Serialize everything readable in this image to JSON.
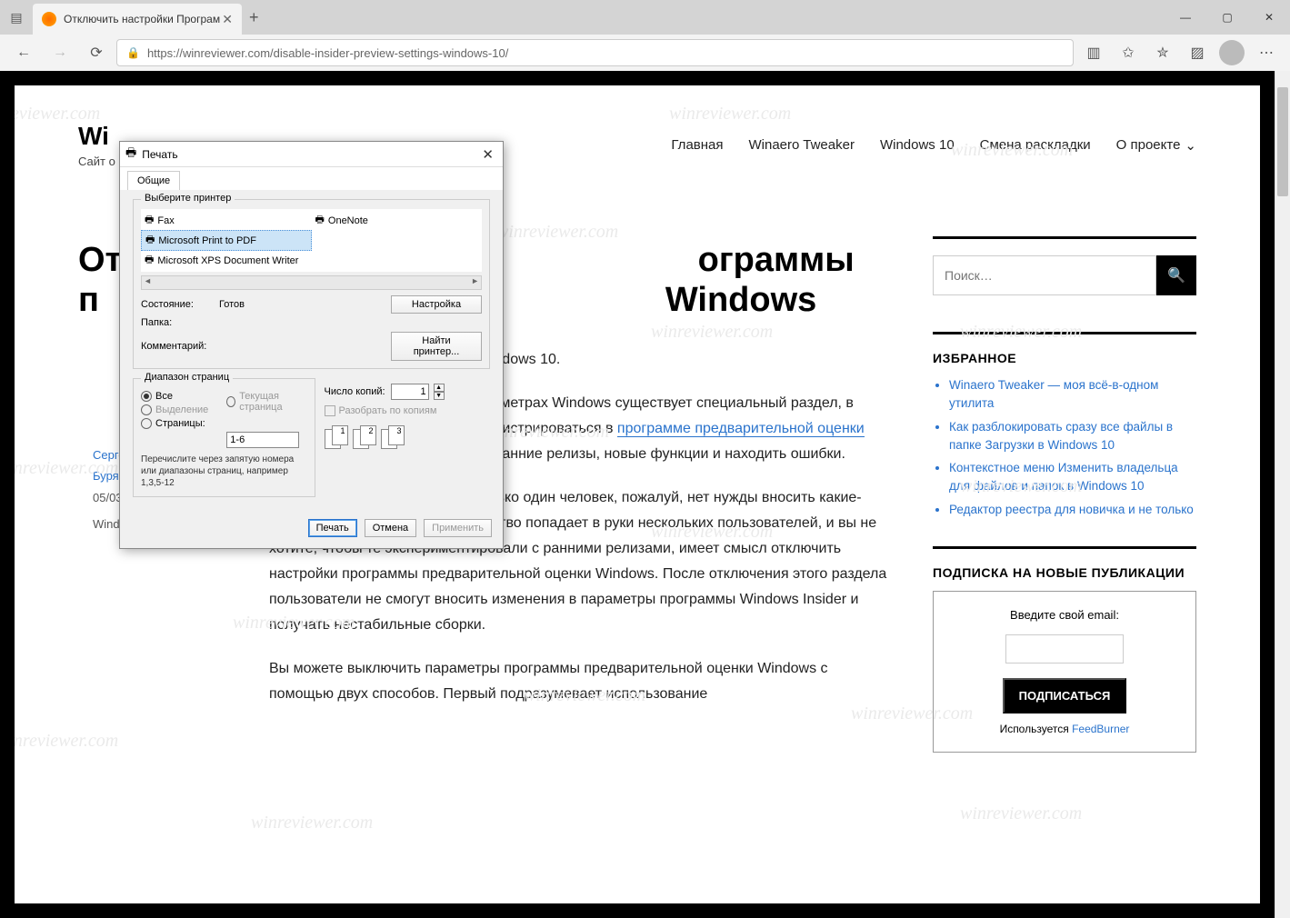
{
  "browser": {
    "tab_title": "Отключить настройки Програм",
    "new_tab_tooltip": "+",
    "url": "https://winreviewer.com/disable-insider-preview-settings-windows-10/",
    "window_controls": {
      "min": "—",
      "max": "▢",
      "close": "✕"
    },
    "nav": {
      "back": "←",
      "forward": "→",
      "refresh": "⟳"
    }
  },
  "site": {
    "title_visible_prefix": "Wi",
    "tagline_visible_prefix": "Сайт о",
    "nav": [
      "Главная",
      "Winaero Tweaker",
      "Windows 10",
      "Смена раскладки",
      "О проекте"
    ]
  },
  "article": {
    "title": "Отключить настройки Программы предварительной оценки Windows",
    "title_visible": "От                                                            ограммы\nп                                                           Windows",
    "author_prefix": "Серге",
    "author_lastname": "Буря",
    "date_prefix": "05/03/",
    "category": "Windows 10",
    "p1_visible_suffix": "ммы предварительной оценки Windows 10.",
    "p2_a": "На протяжении многих лет в Параметрах Windows существует специальный раздел, в котором пользователи могут зарегистрироваться в ",
    "p2_link": "программе предварительной оценки",
    "p2_b": " Windows 10 и затем тестировать ранние релизы, новые функции и находить ошибки.",
    "p3": "Если устройством пользуется только один человек, пожалуй, нет нужды вносить какие-либо изменения. Если же устройство попадает в руки нескольких пользователей, и вы не хотите, чтобы те экспериментировали с ранними релизами, имеет смысл отключить настройки программы предварительной оценки Windows. После отключения этого раздела пользователи не смогут вносить изменения в параметры программы Windows Insider и получать нестабильные сборки.",
    "p4": "Вы можете выключить параметры программы предварительной оценки Windows с помощью двух способов. Первый подразумевает использование"
  },
  "sidebar": {
    "search_placeholder": "Поиск…",
    "featured_heading": "ИЗБРАННОЕ",
    "featured": [
      "Winaero Tweaker — моя всё-в-одном утилита",
      "Как разблокировать сразу все файлы в папке Загрузки в Windows 10",
      "Контекстное меню Изменить владельца для файлов и папок в Windows 10",
      "Редактор реестра для новичка и не только"
    ],
    "subscribe_heading": "ПОДПИСКА НА НОВЫЕ ПУБЛИКАЦИИ",
    "subscribe_label": "Введите свой email:",
    "subscribe_button": "ПОДПИСАТЬСЯ",
    "subscribe_footer_a": "Используется ",
    "subscribe_footer_link": "FeedBurner"
  },
  "print_dialog": {
    "title": "Печать",
    "tab_general": "Общие",
    "group_printer": "Выберите принтер",
    "printers": [
      {
        "name": "Fax"
      },
      {
        "name": "OneNote"
      },
      {
        "name": "Microsoft Print to PDF",
        "selected": true
      },
      {
        "name": "Microsoft XPS Document Writer"
      }
    ],
    "status_label": "Состояние:",
    "status_value": "Готов",
    "folder_label": "Папка:",
    "folder_value": "",
    "comment_label": "Комментарий:",
    "comment_value": "",
    "settings_btn": "Настройка",
    "find_printer_btn": "Найти принтер...",
    "group_range": "Диапазон страниц",
    "range_all": "Все",
    "range_current": "Текущая страница",
    "range_selection": "Выделение",
    "range_pages": "Страницы:",
    "range_pages_value": "1-6",
    "range_hint": "Перечислите через запятую номера или диапазоны страниц, например 1,3,5-12",
    "copies_label": "Число копий:",
    "copies_value": "1",
    "collate_label": "Разобрать по копиям",
    "footer_print": "Печать",
    "footer_cancel": "Отмена",
    "footer_apply": "Применить"
  },
  "watermark_text": "winreviewer.com"
}
